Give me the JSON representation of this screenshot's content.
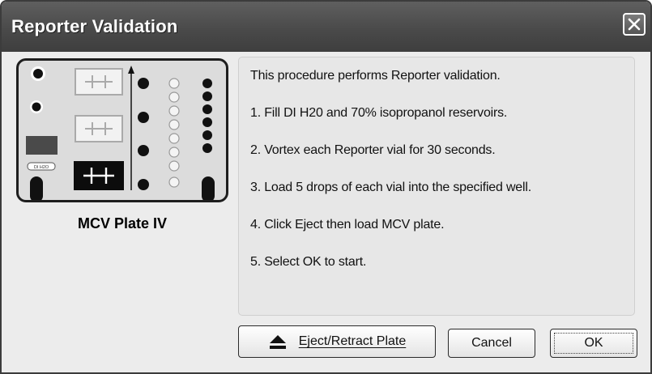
{
  "window": {
    "title": "Reporter Validation",
    "close_icon": "close-icon"
  },
  "plate": {
    "name": "MCV Plate IV",
    "tag_text": "DI H2O"
  },
  "instructions": {
    "intro": "This procedure performs Reporter validation.",
    "steps": [
      "1. Fill DI H20 and 70% isopropanol reservoirs.",
      "2. Vortex each Reporter vial for 30 seconds.",
      "3. Load 5 drops of each vial into the specified well.",
      "4. Click Eject then load MCV plate.",
      "5. Select OK to start."
    ]
  },
  "buttons": {
    "eject_label": "Eject/Retract Plate",
    "eject_icon": "eject-icon",
    "cancel_label": "Cancel",
    "ok_label": "OK"
  },
  "colors": {
    "titlebar": "#4a4a4a",
    "background": "#ececec"
  }
}
